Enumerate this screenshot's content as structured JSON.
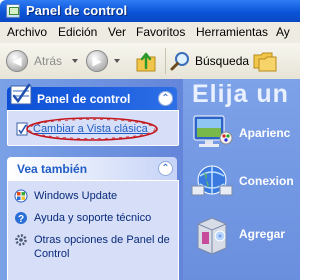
{
  "window": {
    "title": "Panel de control"
  },
  "menu": {
    "items": [
      "Archivo",
      "Edición",
      "Ver",
      "Favoritos",
      "Herramientas",
      "Ay"
    ]
  },
  "toolbar": {
    "back_label": "Atrás",
    "search_label": "Búsqueda"
  },
  "sidebar": {
    "panel": {
      "title": "Panel de control",
      "switch_link": "Cambiar a Vista clásica"
    },
    "see_also": {
      "title": "Vea también",
      "items": [
        {
          "label": "Windows Update",
          "icon": "windows-update-icon"
        },
        {
          "label": "Ayuda y soporte técnico",
          "icon": "help-icon"
        },
        {
          "label": "Otras opciones de Panel de",
          "label2": "Control",
          "icon": "other-options-icon"
        }
      ]
    }
  },
  "main": {
    "heading": "Elija un",
    "categories": [
      {
        "label": "Aparienc",
        "icon": "appearance-icon"
      },
      {
        "label": "Conexion",
        "icon": "network-icon"
      },
      {
        "label": "Agregar",
        "icon": "add-remove-programs-icon"
      }
    ]
  },
  "colors": {
    "accent": "#0b55d8",
    "highlight_oval": "#c4161c",
    "sidebar_bg": "#7aa1e6"
  }
}
